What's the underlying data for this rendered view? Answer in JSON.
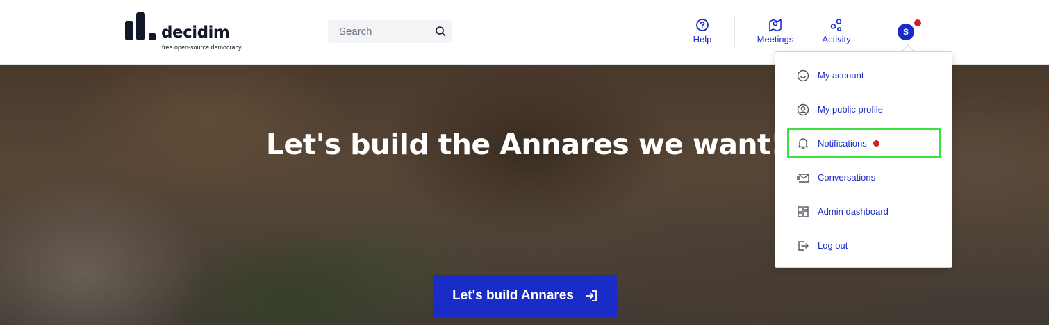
{
  "header": {
    "logo_text": "decidim",
    "logo_tagline": "free open-source democracy",
    "search_placeholder": "Search",
    "nav": {
      "help": "Help",
      "meetings": "Meetings",
      "activity": "Activity"
    },
    "avatar_initial": "S"
  },
  "hero": {
    "title": "Let's build the Annares we want!",
    "button_label": "Let's build Annares"
  },
  "user_menu": {
    "items": [
      {
        "label": "My account",
        "icon": "smile-icon"
      },
      {
        "label": "My public profile",
        "icon": "user-circle-icon"
      },
      {
        "label": "Notifications",
        "icon": "bell-icon"
      },
      {
        "label": "Conversations",
        "icon": "envelope-icon"
      },
      {
        "label": "Admin dashboard",
        "icon": "dashboard-icon"
      },
      {
        "label": "Log out",
        "icon": "logout-icon"
      }
    ]
  },
  "colors": {
    "accent": "#1a2cc7",
    "notification": "#d21d24",
    "highlight": "#3ee23e"
  }
}
